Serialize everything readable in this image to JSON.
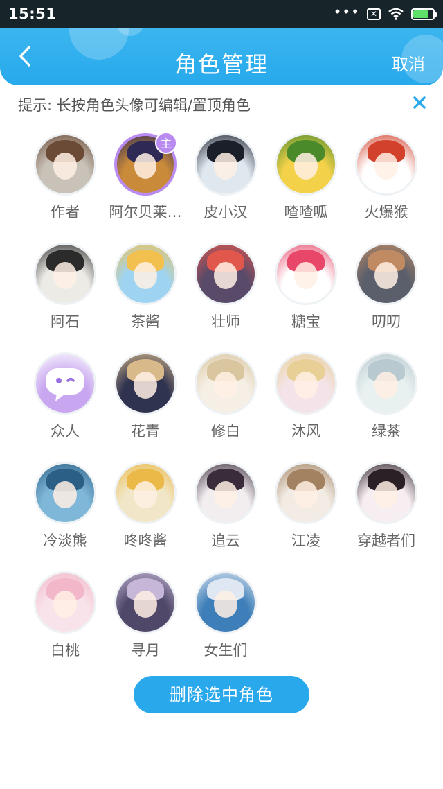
{
  "status_bar": {
    "time": "15:51",
    "battery": 0.8
  },
  "header": {
    "title": "角色管理",
    "cancel_label": "取消"
  },
  "hint": {
    "text": "提示: 长按角色头像可编辑/置顶角色"
  },
  "roles": [
    {
      "name": "作者",
      "icon": "avatar-author",
      "colors": [
        "#c9c2b8",
        "#6b4a36"
      ]
    },
    {
      "name": "阿尔贝莱…",
      "icon": "avatar-boy-blue",
      "colors": [
        "#c98b3a",
        "#2f2a55"
      ],
      "selected": true,
      "badge": "主"
    },
    {
      "name": "皮小汉",
      "icon": "avatar-boy-black-hair",
      "colors": [
        "#dfe7ef",
        "#1b1f2a"
      ]
    },
    {
      "name": "喳喳呱",
      "icon": "avatar-frog",
      "colors": [
        "#f3d24a",
        "#4a8a2a"
      ]
    },
    {
      "name": "火爆猴",
      "icon": "avatar-monkey",
      "colors": [
        "#ffffff",
        "#d2412c"
      ]
    },
    {
      "name": "阿石",
      "icon": "avatar-panda-girl",
      "colors": [
        "#ecebe6",
        "#2c2b2b"
      ]
    },
    {
      "name": "茶酱",
      "icon": "avatar-tea-logo",
      "colors": [
        "#9ed4f2",
        "#f1c04f"
      ]
    },
    {
      "name": "壮师",
      "icon": "avatar-watermelon",
      "colors": [
        "#5a4a6a",
        "#e2574c"
      ]
    },
    {
      "name": "糖宝",
      "icon": "avatar-candy",
      "colors": [
        "#ffffff",
        "#e8476a"
      ]
    },
    {
      "name": "叨叨",
      "icon": "avatar-girl-brown",
      "colors": [
        "#5a5f6b",
        "#c08b63"
      ]
    },
    {
      "name": "众人",
      "icon": "avatar-chat-bubble",
      "colors": [
        "#c9a7f0",
        "#ffffff"
      ]
    },
    {
      "name": "花青",
      "icon": "avatar-girl-navy",
      "colors": [
        "#2f3350",
        "#d8b98a"
      ]
    },
    {
      "name": "修白",
      "icon": "avatar-girl-white",
      "colors": [
        "#f5efe6",
        "#d9c59e"
      ]
    },
    {
      "name": "沐风",
      "icon": "avatar-girl-pastel",
      "colors": [
        "#f4e4e9",
        "#e8cf96"
      ]
    },
    {
      "name": "绿茶",
      "icon": "avatar-girl-mint",
      "colors": [
        "#e8f0f0",
        "#b8c9cf"
      ]
    },
    {
      "name": "冷淡熊",
      "icon": "avatar-bear",
      "colors": [
        "#7fb7d8",
        "#2c5f86"
      ]
    },
    {
      "name": "咚咚酱",
      "icon": "avatar-blonde-girl",
      "colors": [
        "#f1e7c8",
        "#eab948"
      ]
    },
    {
      "name": "追云",
      "icon": "avatar-girl-dark-hair",
      "colors": [
        "#f2eef0",
        "#3a2c3a"
      ]
    },
    {
      "name": "江凌",
      "icon": "avatar-girl-red-ribbon",
      "colors": [
        "#f2ece4",
        "#a38262"
      ]
    },
    {
      "name": "穿越者们",
      "icon": "avatar-girl-black-hair",
      "colors": [
        "#f7eef2",
        "#2a2026"
      ]
    },
    {
      "name": "白桃",
      "icon": "avatar-girl-pink",
      "colors": [
        "#f9e3ea",
        "#f2b7c9"
      ]
    },
    {
      "name": "寻月",
      "icon": "avatar-girl-purple",
      "colors": [
        "#4f4868",
        "#c6b7d8"
      ]
    },
    {
      "name": "女生们",
      "icon": "avatar-girl-blue-sea",
      "colors": [
        "#3f7fb9",
        "#dfe7f2"
      ]
    }
  ],
  "delete_button": {
    "label": "删除选中角色"
  },
  "colors": {
    "accent": "#2aa8ec",
    "selected": "#b98bf0"
  }
}
